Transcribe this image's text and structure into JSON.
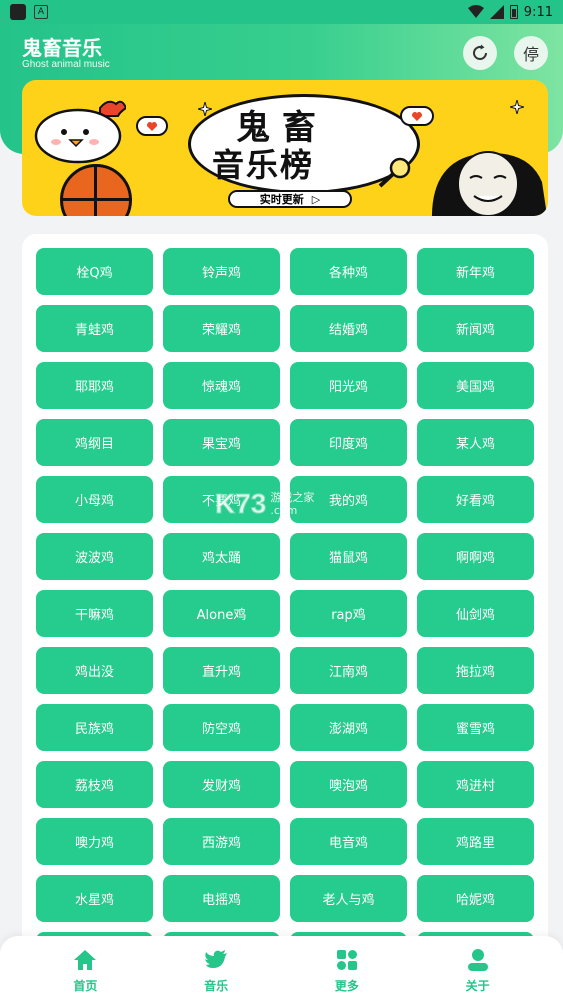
{
  "status_bar": {
    "time": "9:11",
    "notif_letter": "A"
  },
  "header": {
    "title": "鬼畜音乐",
    "subtitle": "Ghost animal music",
    "stop_label": "停"
  },
  "banner": {
    "line1": "鬼畜",
    "line2": "音乐榜",
    "pill_text": "实时更新",
    "pill_arrow": "▷"
  },
  "tags": [
    "栓Q鸡",
    "铃声鸡",
    "各种鸡",
    "新年鸡",
    "青蛙鸡",
    "荣耀鸡",
    "结婚鸡",
    "新闻鸡",
    "耶耶鸡",
    "惊魂鸡",
    "阳光鸡",
    "美国鸡",
    "鸡纲目",
    "果宝鸡",
    "印度鸡",
    "某人鸡",
    "小母鸡",
    "不要鸡",
    "我的鸡",
    "好看鸡",
    "波波鸡",
    "鸡太踊",
    "猫鼠鸡",
    "啊啊鸡",
    "干嘛鸡",
    "Alone鸡",
    "rap鸡",
    "仙剑鸡",
    "鸡出没",
    "直升鸡",
    "江南鸡",
    "拖拉鸡",
    "民族鸡",
    "防空鸡",
    "澎湖鸡",
    "蜜雪鸡",
    "荔枝鸡",
    "发财鸡",
    "噢泡鸡",
    "鸡进村",
    "噢力鸡",
    "西游鸡",
    "电音鸡",
    "鸡路里",
    "水星鸡",
    "电摇鸡",
    "老人与鸡",
    "哈妮鸡",
    "",
    "",
    "",
    ""
  ],
  "watermark": {
    "brand": "K73",
    "line1": "游戏之家",
    "line2": ".com"
  },
  "nav": [
    {
      "label": "首页",
      "icon": "home-icon"
    },
    {
      "label": "音乐",
      "icon": "twitter-bird-icon"
    },
    {
      "label": "更多",
      "icon": "more-icon"
    },
    {
      "label": "关于",
      "icon": "user-icon"
    }
  ],
  "colors": {
    "primary": "#26cc8d",
    "banner_yellow": "#ffd21a"
  }
}
